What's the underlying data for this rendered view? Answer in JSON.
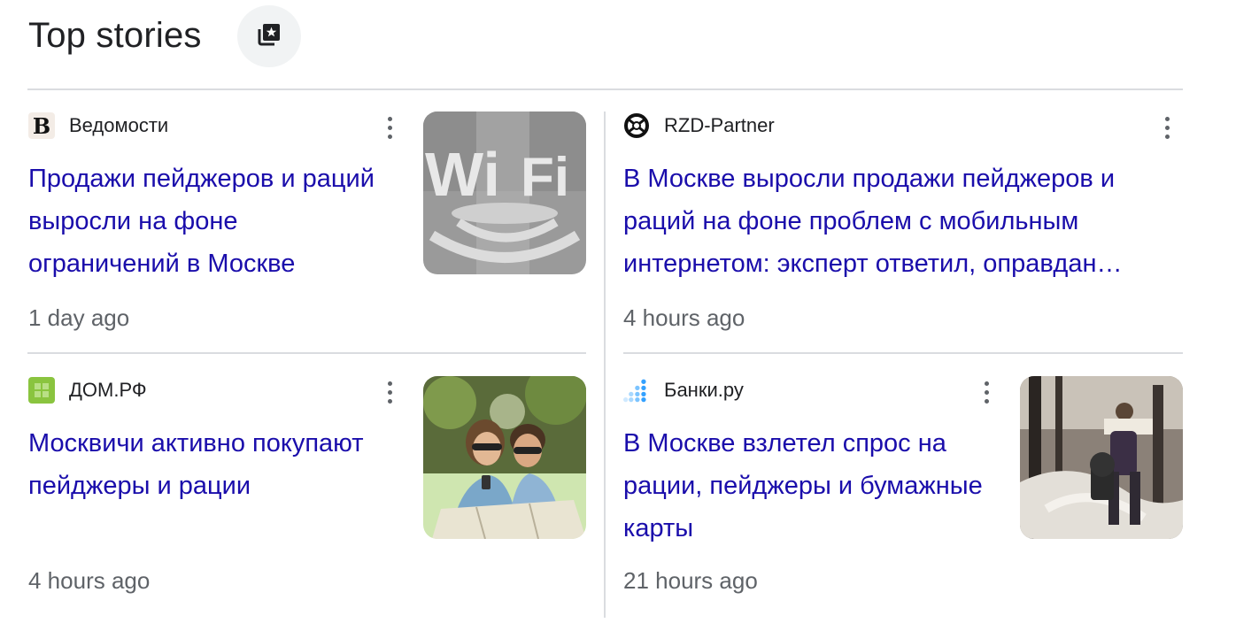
{
  "header": {
    "title": "Top stories",
    "stories_icon": "stacked-stories-star-icon"
  },
  "cards": [
    {
      "source": "Ведомости",
      "logo_icon": "vedomosti-logo",
      "headline": "Продажи пейджеров и раций выросли на фоне ограничений в Москве",
      "time": "1 day ago",
      "thumbnail": "wifi-sign-image"
    },
    {
      "source": "RZD-Partner",
      "logo_icon": "rzd-partner-logo",
      "headline_line1": "В Москве выросли продажи пейджеров и",
      "headline_line2": "раций на фоне проблем с мобильным",
      "headline_line3": "интернетом: эксперт ответил, оправдан…",
      "time": "4 hours ago"
    },
    {
      "source": "ДОМ.РФ",
      "logo_icon": "domrf-logo",
      "headline": "Москвичи активно покупают пейджеры и рации",
      "time": "4 hours ago",
      "thumbnail": "couple-with-map-image"
    },
    {
      "source": "Банки.ру",
      "logo_icon": "bankiru-logo",
      "headline": "В Москве взлетел спрос на рации, пейджеры и бумажные карты",
      "time": "21 hours ago",
      "thumbnail": "person-reading-map-winter-image"
    }
  ],
  "colors": {
    "headline": "#1a0dab",
    "meta": "#5f6368",
    "divider": "#dadce0"
  }
}
